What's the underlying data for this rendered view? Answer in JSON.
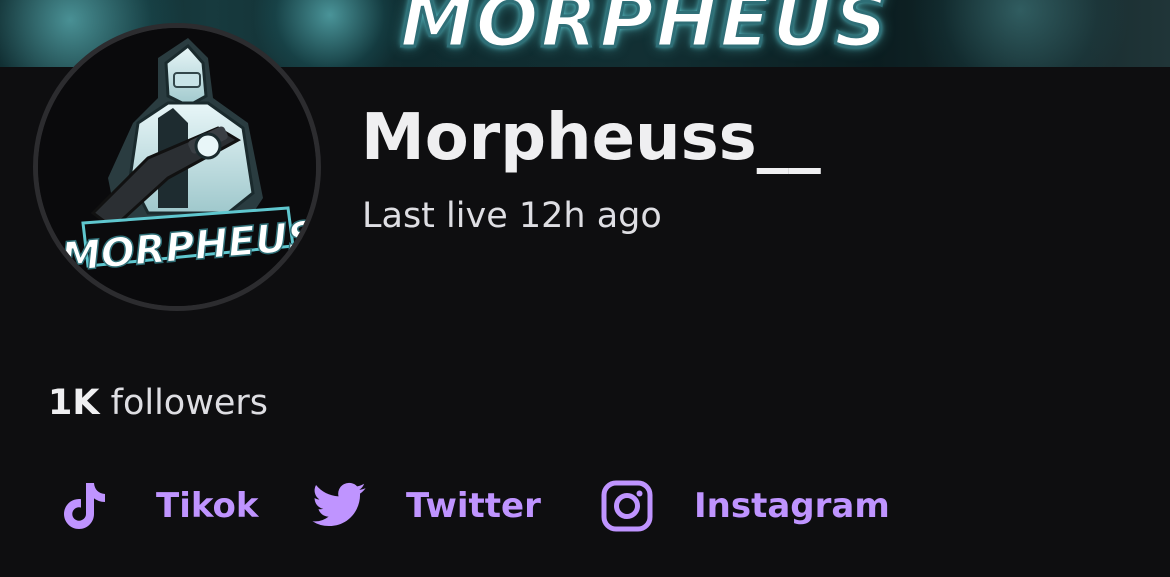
{
  "banner": {
    "text": "MORPHEUS"
  },
  "profile": {
    "avatar_text": "MORPHEUS",
    "username": "Morpheuss__",
    "last_live": "Last live 12h ago"
  },
  "followers": {
    "count": "1K",
    "label": "followers"
  },
  "social_links": [
    {
      "label": "Tikok",
      "icon": "tiktok-icon"
    },
    {
      "label": "Twitter",
      "icon": "twitter-icon"
    },
    {
      "label": "Instagram",
      "icon": "instagram-icon"
    }
  ],
  "colors": {
    "background": "#0e0e10",
    "text": "#efeff1",
    "accent": "#bf94ff",
    "banner_glow": "#63d6de"
  }
}
